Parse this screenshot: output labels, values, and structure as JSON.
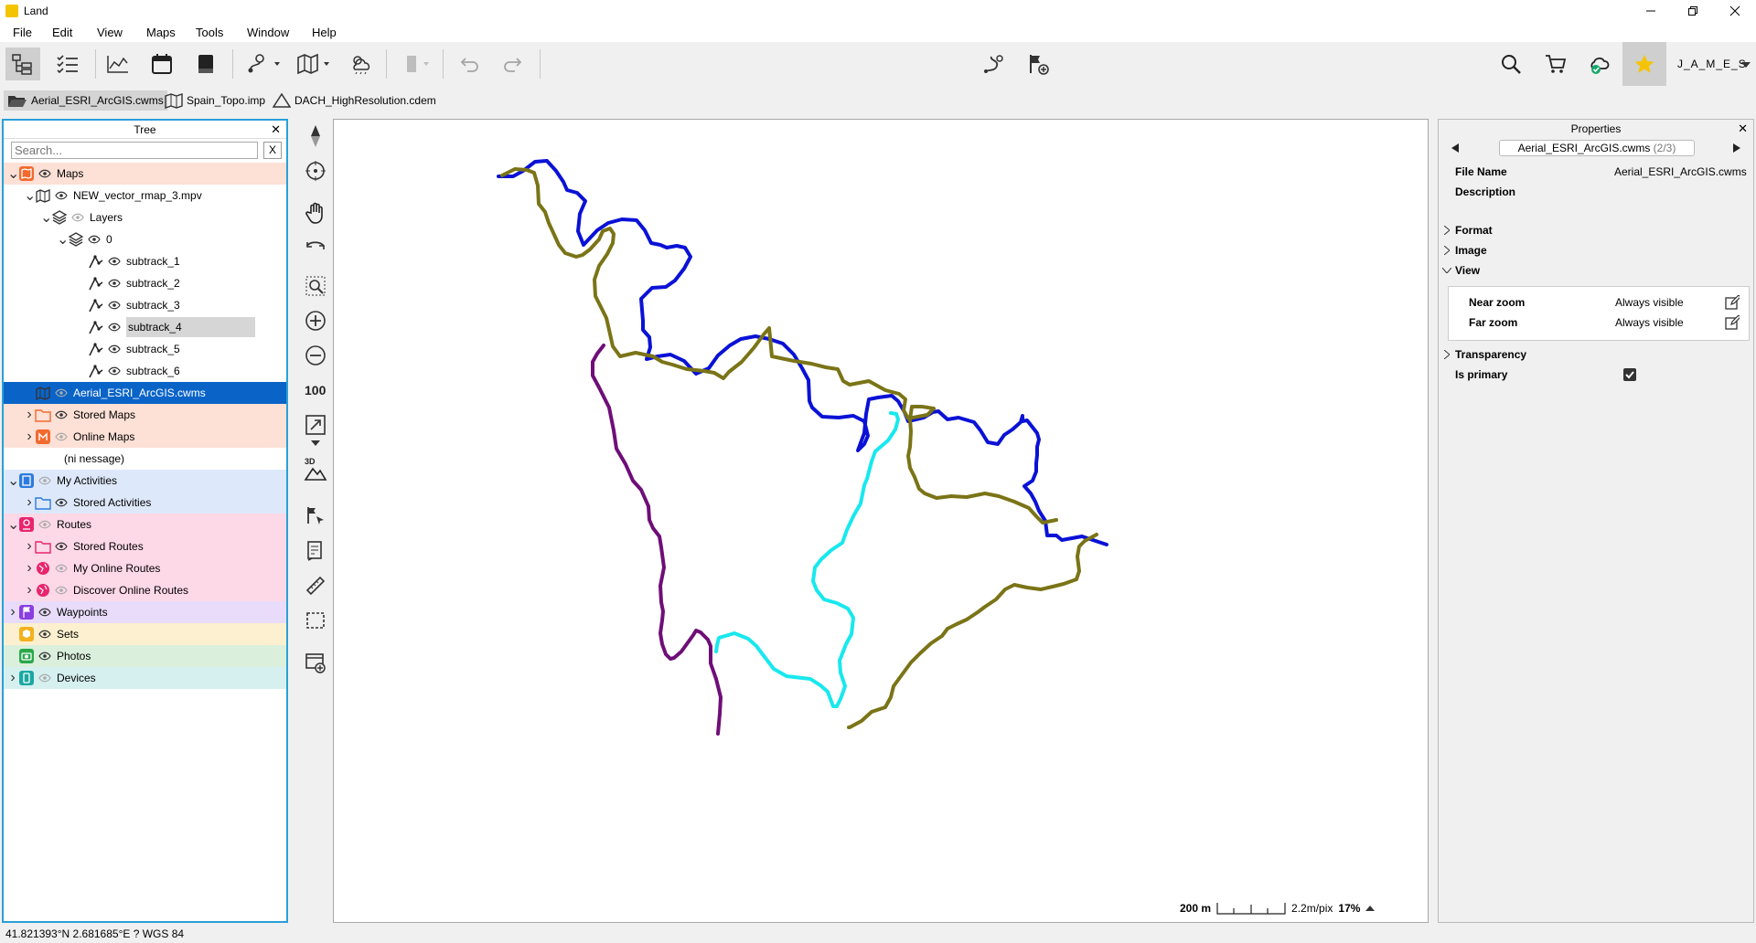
{
  "window": {
    "title": "Land"
  },
  "menu": [
    "File",
    "Edit",
    "View",
    "Maps",
    "Tools",
    "Window",
    "Help"
  ],
  "user": {
    "name": "J_A_M_E_S"
  },
  "doc_tabs": [
    {
      "label": "Aerial_ESRI_ArcGIS.cwms",
      "icon": "folder-open-icon"
    },
    {
      "label": "Spain_Topo.imp",
      "icon": "map-icon"
    },
    {
      "label": "DACH_HighResolution.cdem",
      "icon": "terrain-icon"
    }
  ],
  "tree": {
    "title": "Tree",
    "search": {
      "placeholder": "Search...",
      "value": "",
      "clear": "X"
    },
    "rows": [
      {
        "label": "Maps",
        "bg": "#fde0d6"
      },
      {
        "label": "NEW_vector_rmap_3.mpv",
        "bg": "#ffffff"
      },
      {
        "label": "Layers",
        "bg": "#ffffff"
      },
      {
        "label": "0",
        "bg": "#ffffff"
      },
      {
        "label": "subtrack_1",
        "bg": "#ffffff"
      },
      {
        "label": "subtrack_2",
        "bg": "#ffffff"
      },
      {
        "label": "subtrack_3",
        "bg": "#ffffff"
      },
      {
        "label": "subtrack_4",
        "bg": "#ffffff"
      },
      {
        "label": "subtrack_5",
        "bg": "#ffffff"
      },
      {
        "label": "subtrack_6",
        "bg": "#ffffff"
      },
      {
        "label": "Aerial_ESRI_ArcGIS.cwms",
        "bg": "#0a64c8"
      },
      {
        "label": "Stored Maps",
        "bg": "#fde0d6"
      },
      {
        "label": "Online Maps",
        "bg": "#fde0d6"
      },
      {
        "label": "(ni nessage)",
        "bg": "#ffffff"
      },
      {
        "label": "My Activities",
        "bg": "#dde9fb"
      },
      {
        "label": "Stored Activities",
        "bg": "#dde9fb"
      },
      {
        "label": "Routes",
        "bg": "#fdd8e6"
      },
      {
        "label": "Stored Routes",
        "bg": "#fdd8e6"
      },
      {
        "label": "My Online Routes",
        "bg": "#fdd8e6"
      },
      {
        "label": "Discover Online Routes",
        "bg": "#fdd8e6"
      },
      {
        "label": "Waypoints",
        "bg": "#e8dcfa"
      },
      {
        "label": "Sets",
        "bg": "#fdf0d0"
      },
      {
        "label": "Photos",
        "bg": "#daf0dc"
      },
      {
        "label": "Devices",
        "bg": "#d6f0f0"
      }
    ]
  },
  "map": {
    "scale_label": "200 m",
    "resolution": "2.2m/pix",
    "zoom": "17%",
    "track_colors": [
      "#0a12d6",
      "#7a7417",
      "#6f0e78",
      "#18e8ee"
    ]
  },
  "properties": {
    "title": "Properties",
    "file_selector": "Aerial_ESRI_ArcGIS.cwms",
    "file_counter": "(2/3)",
    "file_name_label": "File Name",
    "file_name_value": "Aerial_ESRI_ArcGIS.cwms",
    "description_label": "Description",
    "sections": [
      "Format",
      "Image",
      "View"
    ],
    "near_zoom_label": "Near zoom",
    "near_zoom_value": "Always visible",
    "far_zoom_label": "Far zoom",
    "far_zoom_value": "Always visible",
    "transparency_label": "Transparency",
    "is_primary_label": "Is primary",
    "is_primary": true
  },
  "status": {
    "text": "41.821393°N 2.681685°E  ?  WGS 84"
  }
}
